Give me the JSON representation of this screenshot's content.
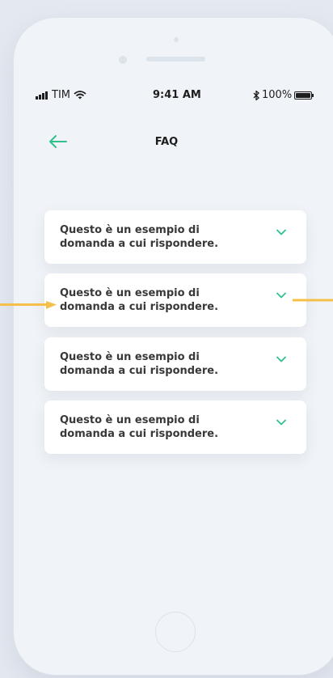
{
  "status_bar": {
    "carrier": "TIM",
    "time": "9:41 AM",
    "battery": "100%",
    "battery_level": 1.0
  },
  "header": {
    "title": "FAQ",
    "back_icon": "arrow-left-icon"
  },
  "faq": {
    "items": [
      {
        "question": "Questo è un esempio di domanda a cui rispondere.",
        "icon": "chevron-down-icon"
      },
      {
        "question": "Questo è un esempio di domanda a cui rispondere.",
        "icon": "chevron-down-icon"
      },
      {
        "question": "Questo è un esempio di domanda a cui rispondere.",
        "icon": "chevron-down-icon"
      },
      {
        "question": "Questo è un esempio di domanda a cui rispondere.",
        "icon": "chevron-down-icon"
      }
    ]
  },
  "colors": {
    "accent": "#2fc08b",
    "annotation": "#f5c04a",
    "text": "#383838",
    "background": "#f0f3f7"
  }
}
